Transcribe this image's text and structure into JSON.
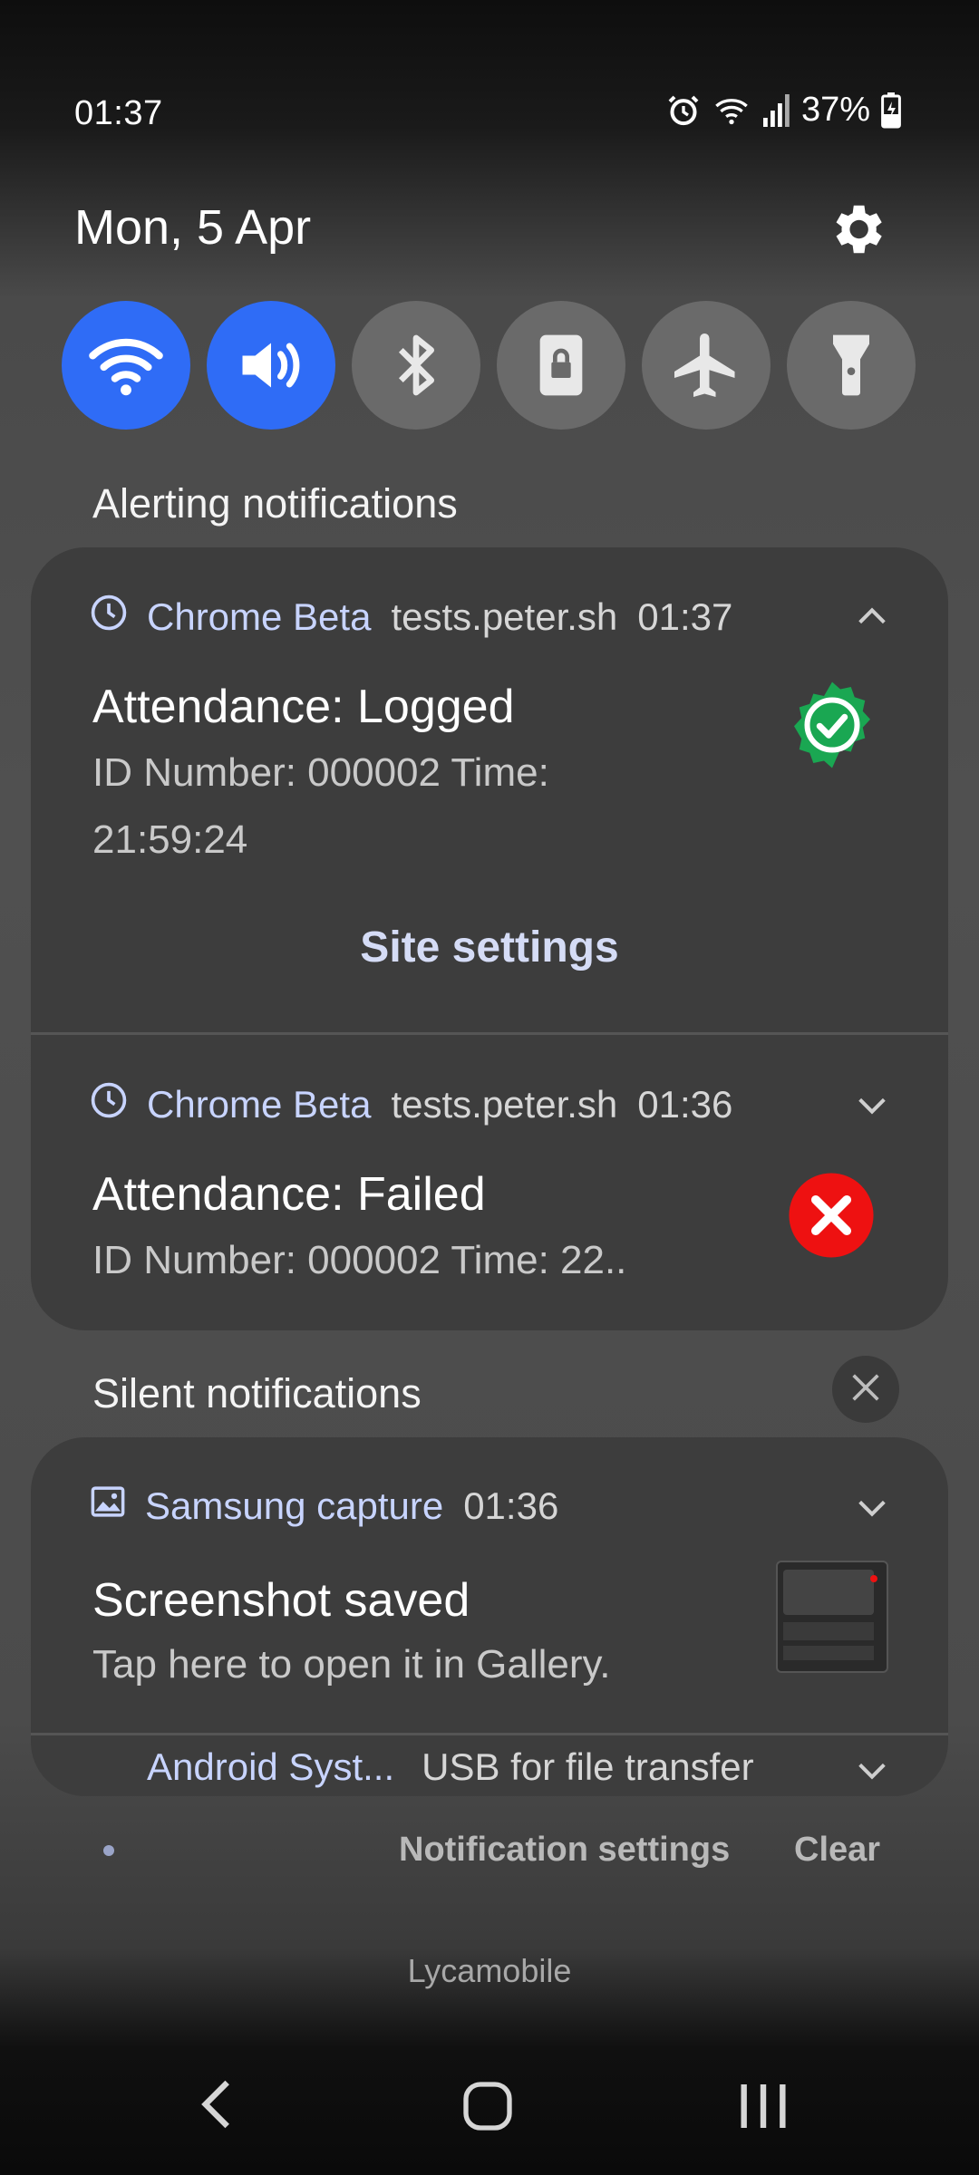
{
  "status_bar": {
    "time": "01:37",
    "battery": "37%",
    "icons": [
      "alarm-icon",
      "wifi-signal-icon",
      "cell-signal-icon",
      "battery-charging-icon"
    ]
  },
  "panel": {
    "date": "Mon, 5 Apr",
    "quick_toggles": [
      {
        "name": "wifi",
        "icon": "wifi-icon",
        "on": true
      },
      {
        "name": "sound",
        "icon": "sound-icon",
        "on": true
      },
      {
        "name": "bluetooth",
        "icon": "bluetooth-icon",
        "on": false
      },
      {
        "name": "screen-lock",
        "icon": "lock-rotation-icon",
        "on": false
      },
      {
        "name": "airplane",
        "icon": "airplane-icon",
        "on": false
      },
      {
        "name": "flashlight",
        "icon": "flashlight-icon",
        "on": false
      }
    ]
  },
  "alerting": {
    "title": "Alerting notifications",
    "items": [
      {
        "app": "Chrome Beta",
        "source": "tests.peter.sh",
        "time": "01:37",
        "title": "Attendance: Logged",
        "line1": "ID Number: 000002      Time:",
        "line2": "21:59:24",
        "action": "Site settings",
        "status_color": "#1aa752"
      },
      {
        "app": "Chrome Beta",
        "source": "tests.peter.sh",
        "time": "01:36",
        "title": "Attendance: Failed",
        "line1": "ID Number: 000002      Time: 22..",
        "status_color": "#ee1111"
      }
    ]
  },
  "silent": {
    "title": "Silent notifications",
    "items": [
      {
        "app": "Samsung capture",
        "time": "01:36",
        "title": "Screenshot saved",
        "text": "Tap here to open it in Gallery."
      },
      {
        "app": "Android Syst...",
        "text": "USB for file transfer"
      }
    ]
  },
  "footer": {
    "notification_settings": "Notification settings",
    "clear": "Clear",
    "carrier": "Lycamobile"
  },
  "colors": {
    "accent": "#2f6cf6",
    "card": "#3d3d3d",
    "app_name": "#c8d4ff"
  }
}
